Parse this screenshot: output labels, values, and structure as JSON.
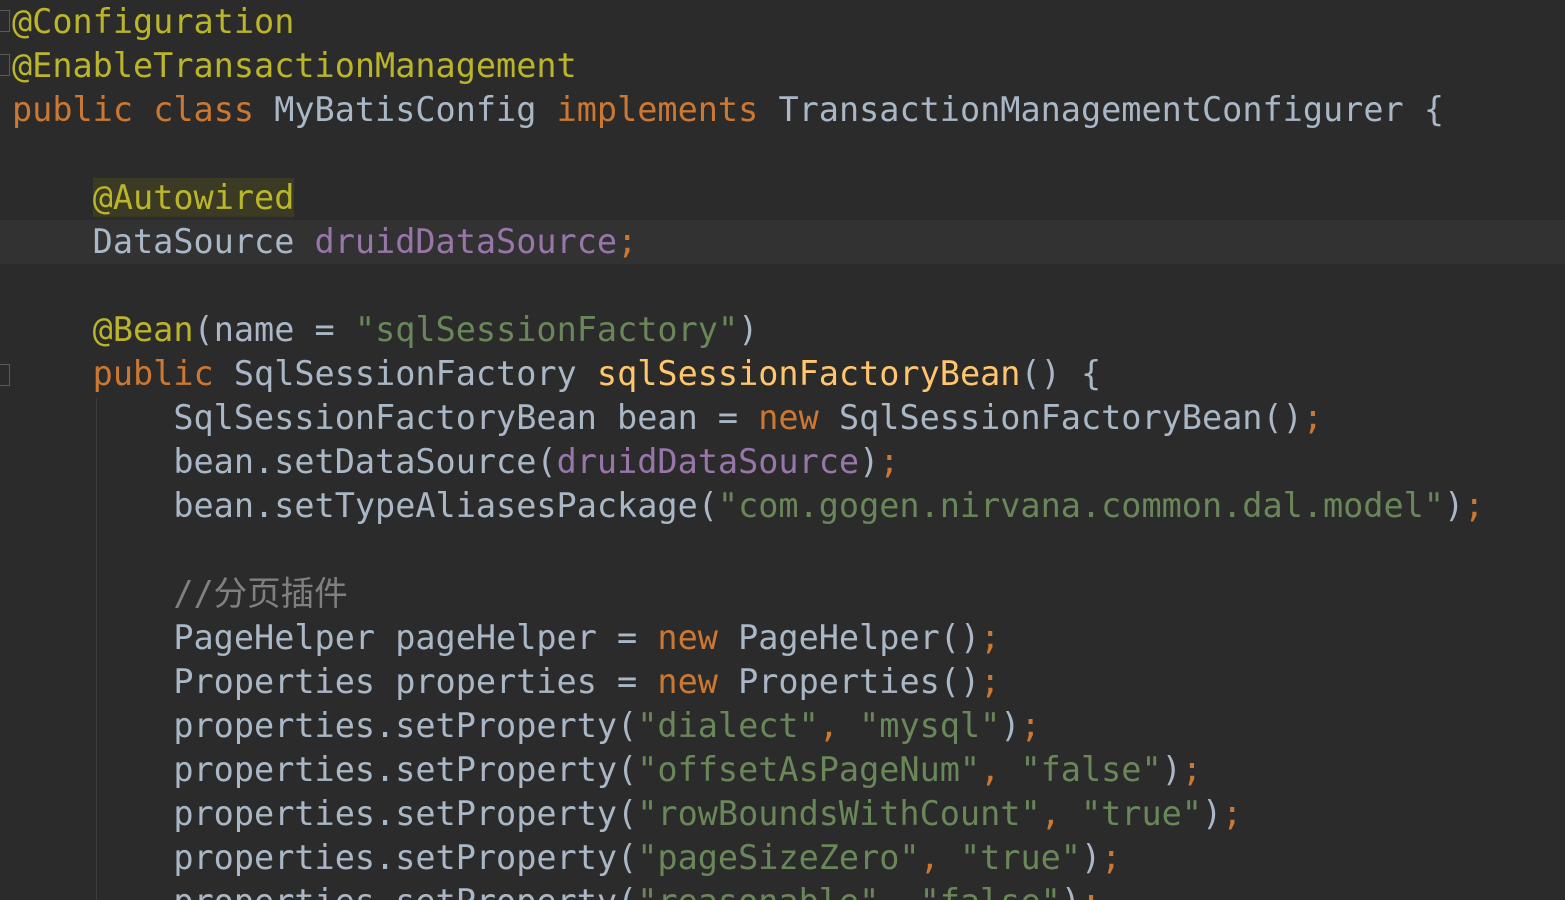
{
  "editor": {
    "lines": [
      {
        "tokens": [
          {
            "t": "@Configuration",
            "c": "tok-ann"
          }
        ]
      },
      {
        "tokens": [
          {
            "t": "@EnableTransactionManagement",
            "c": "tok-ann"
          }
        ]
      },
      {
        "tokens": [
          {
            "t": "public ",
            "c": "tok-kw"
          },
          {
            "t": "class ",
            "c": "tok-kw"
          },
          {
            "t": "MyBatisConfig ",
            "c": "tok-plain"
          },
          {
            "t": "implements ",
            "c": "tok-kw"
          },
          {
            "t": "TransactionManagementConfigurer {",
            "c": "tok-plain"
          }
        ]
      },
      {
        "tokens": []
      },
      {
        "tokens": [
          {
            "t": "    ",
            "c": "tok-plain"
          },
          {
            "t": "@Autowired",
            "c": "tok-ann-hl"
          }
        ]
      },
      {
        "current": true,
        "tokens": [
          {
            "t": "    DataSource ",
            "c": "tok-plain"
          },
          {
            "t": "druidDataSource",
            "c": "tok-field"
          },
          {
            "t": ";",
            "c": "tok-kw"
          }
        ]
      },
      {
        "tokens": []
      },
      {
        "tokens": [
          {
            "t": "    @Bean",
            "c": "tok-ann"
          },
          {
            "t": "(",
            "c": "tok-plain"
          },
          {
            "t": "name",
            "c": "tok-param"
          },
          {
            "t": " = ",
            "c": "tok-plain"
          },
          {
            "t": "\"sqlSessionFactory\"",
            "c": "tok-str"
          },
          {
            "t": ")",
            "c": "tok-plain"
          }
        ]
      },
      {
        "tokens": [
          {
            "t": "    public ",
            "c": "tok-kw"
          },
          {
            "t": "SqlSessionFactory ",
            "c": "tok-plain"
          },
          {
            "t": "sqlSessionFactoryBean",
            "c": "tok-fn"
          },
          {
            "t": "() {",
            "c": "tok-plain"
          }
        ]
      },
      {
        "tokens": [
          {
            "t": "        SqlSessionFactoryBean bean = ",
            "c": "tok-plain"
          },
          {
            "t": "new ",
            "c": "tok-kw"
          },
          {
            "t": "SqlSessionFactoryBean()",
            "c": "tok-plain"
          },
          {
            "t": ";",
            "c": "tok-kw"
          }
        ]
      },
      {
        "tokens": [
          {
            "t": "        bean.setDataSource(",
            "c": "tok-plain"
          },
          {
            "t": "druidDataSource",
            "c": "tok-field"
          },
          {
            "t": ")",
            "c": "tok-plain"
          },
          {
            "t": ";",
            "c": "tok-kw"
          }
        ]
      },
      {
        "tokens": [
          {
            "t": "        bean.setTypeAliasesPackage(",
            "c": "tok-plain"
          },
          {
            "t": "\"com.gogen.nirvana.common.dal.model\"",
            "c": "tok-str"
          },
          {
            "t": ")",
            "c": "tok-plain"
          },
          {
            "t": ";",
            "c": "tok-kw"
          }
        ]
      },
      {
        "tokens": []
      },
      {
        "tokens": [
          {
            "t": "        //分页插件",
            "c": "tok-com"
          }
        ]
      },
      {
        "tokens": [
          {
            "t": "        PageHelper pageHelper = ",
            "c": "tok-plain"
          },
          {
            "t": "new ",
            "c": "tok-kw"
          },
          {
            "t": "PageHelper()",
            "c": "tok-plain"
          },
          {
            "t": ";",
            "c": "tok-kw"
          }
        ]
      },
      {
        "tokens": [
          {
            "t": "        Properties properties = ",
            "c": "tok-plain"
          },
          {
            "t": "new ",
            "c": "tok-kw"
          },
          {
            "t": "Properties()",
            "c": "tok-plain"
          },
          {
            "t": ";",
            "c": "tok-kw"
          }
        ]
      },
      {
        "tokens": [
          {
            "t": "        properties.setProperty(",
            "c": "tok-plain"
          },
          {
            "t": "\"dialect\"",
            "c": "tok-str"
          },
          {
            "t": ", ",
            "c": "tok-kw"
          },
          {
            "t": "\"mysql\"",
            "c": "tok-str"
          },
          {
            "t": ")",
            "c": "tok-plain"
          },
          {
            "t": ";",
            "c": "tok-kw"
          }
        ]
      },
      {
        "tokens": [
          {
            "t": "        properties.setProperty(",
            "c": "tok-plain"
          },
          {
            "t": "\"offsetAsPageNum\"",
            "c": "tok-str"
          },
          {
            "t": ", ",
            "c": "tok-kw"
          },
          {
            "t": "\"false\"",
            "c": "tok-str"
          },
          {
            "t": ")",
            "c": "tok-plain"
          },
          {
            "t": ";",
            "c": "tok-kw"
          }
        ]
      },
      {
        "tokens": [
          {
            "t": "        properties.setProperty(",
            "c": "tok-plain"
          },
          {
            "t": "\"rowBoundsWithCount\"",
            "c": "tok-str"
          },
          {
            "t": ", ",
            "c": "tok-kw"
          },
          {
            "t": "\"true\"",
            "c": "tok-str"
          },
          {
            "t": ")",
            "c": "tok-plain"
          },
          {
            "t": ";",
            "c": "tok-kw"
          }
        ]
      },
      {
        "tokens": [
          {
            "t": "        properties.setProperty(",
            "c": "tok-plain"
          },
          {
            "t": "\"pageSizeZero\"",
            "c": "tok-str"
          },
          {
            "t": ", ",
            "c": "tok-kw"
          },
          {
            "t": "\"true\"",
            "c": "tok-str"
          },
          {
            "t": ")",
            "c": "tok-plain"
          },
          {
            "t": ";",
            "c": "tok-kw"
          }
        ]
      },
      {
        "tokens": [
          {
            "t": "        properties.setProperty(",
            "c": "tok-plain"
          },
          {
            "t": "\"reasonable\"",
            "c": "tok-str"
          },
          {
            "t": ", ",
            "c": "tok-kw"
          },
          {
            "t": "\"false\"",
            "c": "tok-str"
          },
          {
            "t": ")",
            "c": "tok-plain"
          },
          {
            "t": ";",
            "c": "tok-kw"
          }
        ]
      }
    ]
  },
  "gutter": {
    "bulb_icon": "lightbulb-icon",
    "bulb_color": "#e8c45a"
  }
}
